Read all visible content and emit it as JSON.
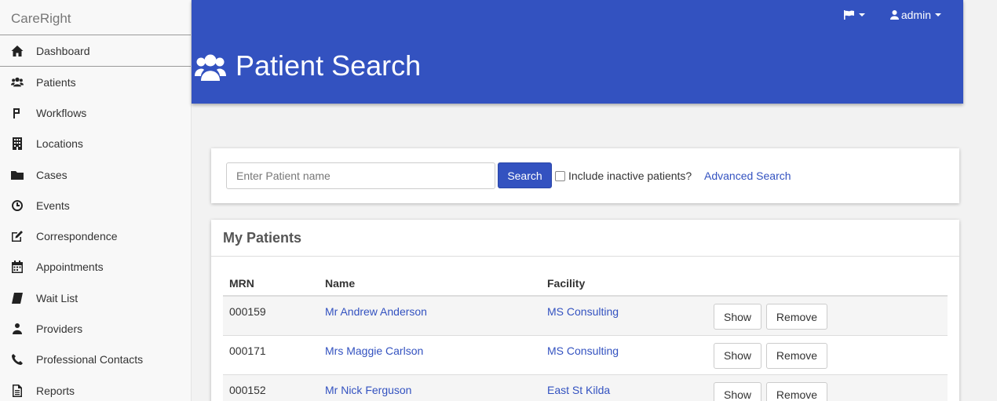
{
  "sidebar": {
    "brand": "CareRight",
    "items": [
      {
        "label": "Dashboard",
        "icon": "home-icon"
      },
      {
        "label": "Patients",
        "icon": "users-icon"
      },
      {
        "label": "Workflows",
        "icon": "branch-icon"
      },
      {
        "label": "Locations",
        "icon": "building-icon"
      },
      {
        "label": "Cases",
        "icon": "folder-icon"
      },
      {
        "label": "Events",
        "icon": "clock-icon"
      },
      {
        "label": "Correspondence",
        "icon": "edit-icon"
      },
      {
        "label": "Appointments",
        "icon": "calendar-icon"
      },
      {
        "label": "Wait List",
        "icon": "book-icon"
      },
      {
        "label": "Providers",
        "icon": "user-md-icon"
      },
      {
        "label": "Professional Contacts",
        "icon": "phone-icon"
      },
      {
        "label": "Reports",
        "icon": "file-icon"
      }
    ]
  },
  "header": {
    "title": "Patient Search",
    "user_label": "admin"
  },
  "search": {
    "placeholder": "Enter Patient name",
    "value": "",
    "button_label": "Search",
    "inactive_label": "Include inactive patients?",
    "inactive_checked": false,
    "advanced_label": "Advanced Search"
  },
  "patients": {
    "heading": "My Patients",
    "columns": {
      "mrn": "MRN",
      "name": "Name",
      "facility": "Facility"
    },
    "show_label": "Show",
    "remove_label": "Remove",
    "rows": [
      {
        "mrn": "000159",
        "name": "Mr Andrew Anderson",
        "facility": "MS Consulting"
      },
      {
        "mrn": "000171",
        "name": "Mrs Maggie Carlson",
        "facility": "MS Consulting"
      },
      {
        "mrn": "000152",
        "name": "Mr Nick Ferguson",
        "facility": "East St Kilda"
      }
    ]
  },
  "colors": {
    "primary": "#3352c0",
    "link": "#3352c0"
  }
}
